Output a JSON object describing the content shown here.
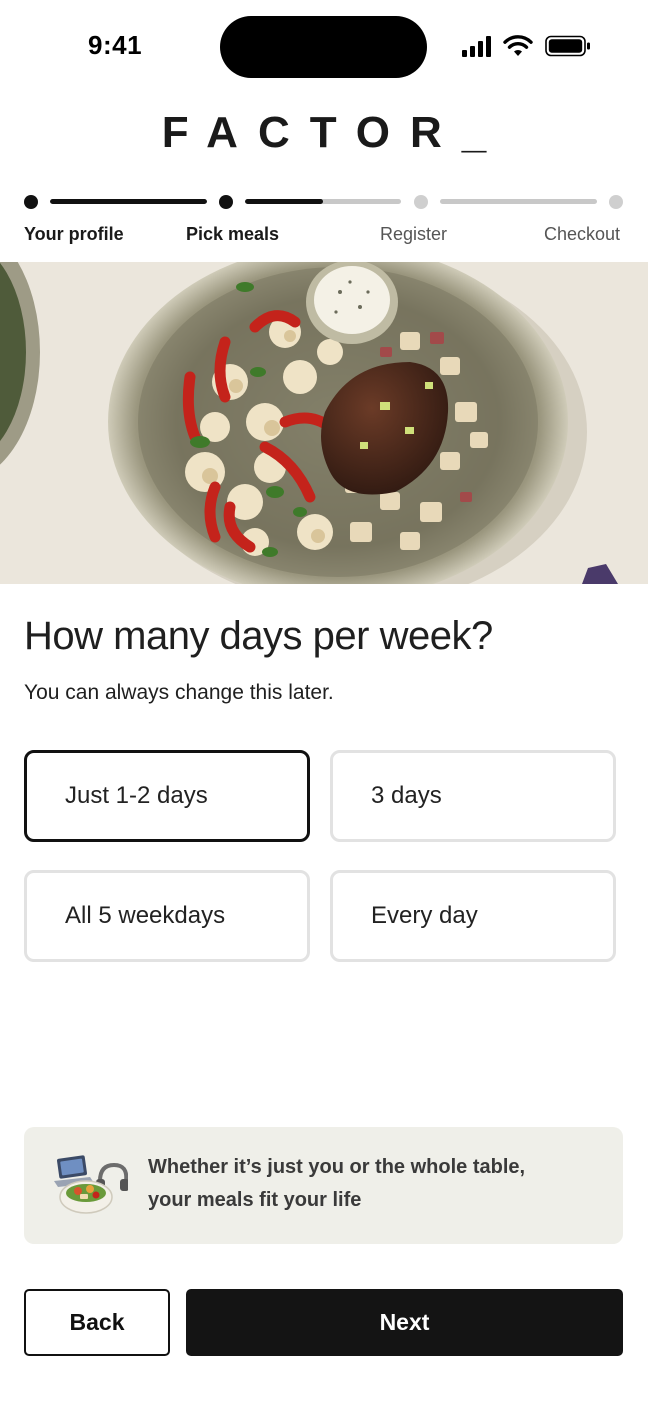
{
  "status_bar": {
    "time": "9:41",
    "icons": [
      "signal-icon",
      "wifi-icon",
      "battery-icon"
    ]
  },
  "brand": {
    "logo_text": "FACTOR_"
  },
  "progress": {
    "steps": [
      {
        "label": "Your profile",
        "state": "complete"
      },
      {
        "label": "Pick meals",
        "state": "in-progress",
        "fill": 0.5
      },
      {
        "label": "Register",
        "state": "pending"
      },
      {
        "label": "Checkout",
        "state": "pending"
      }
    ]
  },
  "hero": {
    "image": "plate-of-roasted-cauliflower-peppers-and-steak"
  },
  "question": {
    "title": "How many days per week?",
    "subtitle": "You can always change this later."
  },
  "options": [
    {
      "label": "Just 1-2 days",
      "selected": true
    },
    {
      "label": "3 days",
      "selected": false
    },
    {
      "label": "All 5 weekdays",
      "selected": false
    },
    {
      "label": "Every day",
      "selected": false
    }
  ],
  "promo": {
    "icon": "laptop-bowl-headphones-illustration",
    "line1": "Whether it’s just you or the whole table,",
    "line2": "your meals fit your life"
  },
  "actions": {
    "back_label": "Back",
    "next_label": "Next"
  },
  "colors": {
    "primary": "#141414",
    "muted_bar": "#c8c8c8",
    "promo_bg": "#efefe9",
    "option_border": "#e2e2e2"
  }
}
